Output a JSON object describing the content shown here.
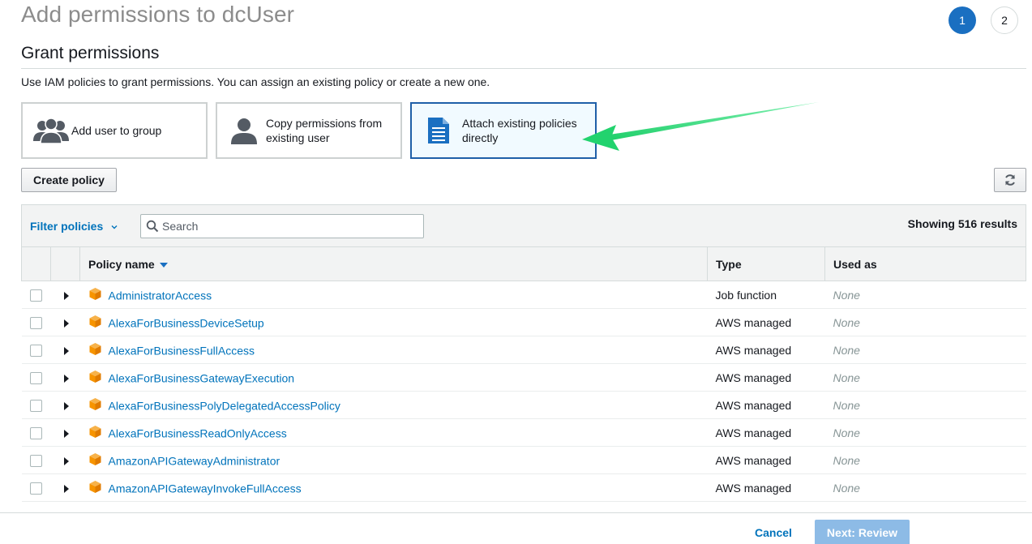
{
  "header": {
    "title": "Add permissions to dcUser",
    "steps": [
      "1",
      "2"
    ],
    "active_step": "1"
  },
  "section": {
    "title": "Grant permissions",
    "description": "Use IAM policies to grant permissions. You can assign an existing policy or create a new one."
  },
  "options": [
    {
      "label": "Add user to group",
      "icon": "users-group-icon",
      "selected": false
    },
    {
      "label": "Copy permissions from existing user",
      "icon": "user-icon",
      "selected": false
    },
    {
      "label": "Attach existing policies directly",
      "icon": "document-icon",
      "selected": true
    }
  ],
  "toolbar": {
    "create_policy_label": "Create policy",
    "refresh_icon": "refresh-icon"
  },
  "filter": {
    "label": "Filter policies",
    "search_placeholder": "Search",
    "results_text": "Showing 516 results"
  },
  "table": {
    "columns": {
      "name": "Policy name",
      "type": "Type",
      "used_as": "Used as"
    },
    "rows": [
      {
        "name": "AdministratorAccess",
        "type": "Job function",
        "used_as": "None"
      },
      {
        "name": "AlexaForBusinessDeviceSetup",
        "type": "AWS managed",
        "used_as": "None"
      },
      {
        "name": "AlexaForBusinessFullAccess",
        "type": "AWS managed",
        "used_as": "None"
      },
      {
        "name": "AlexaForBusinessGatewayExecution",
        "type": "AWS managed",
        "used_as": "None"
      },
      {
        "name": "AlexaForBusinessPolyDelegatedAccessPolicy",
        "type": "AWS managed",
        "used_as": "None"
      },
      {
        "name": "AlexaForBusinessReadOnlyAccess",
        "type": "AWS managed",
        "used_as": "None"
      },
      {
        "name": "AmazonAPIGatewayAdministrator",
        "type": "AWS managed",
        "used_as": "None"
      },
      {
        "name": "AmazonAPIGatewayInvokeFullAccess",
        "type": "AWS managed",
        "used_as": "None"
      }
    ]
  },
  "footer": {
    "cancel_label": "Cancel",
    "next_label": "Next: Review"
  },
  "colors": {
    "link": "#0073bb",
    "step_active": "#1a6fc1",
    "selected_border": "#1f5fa8",
    "annotation_arrow": "#2ecc71",
    "policy_icon": "#f79400"
  }
}
